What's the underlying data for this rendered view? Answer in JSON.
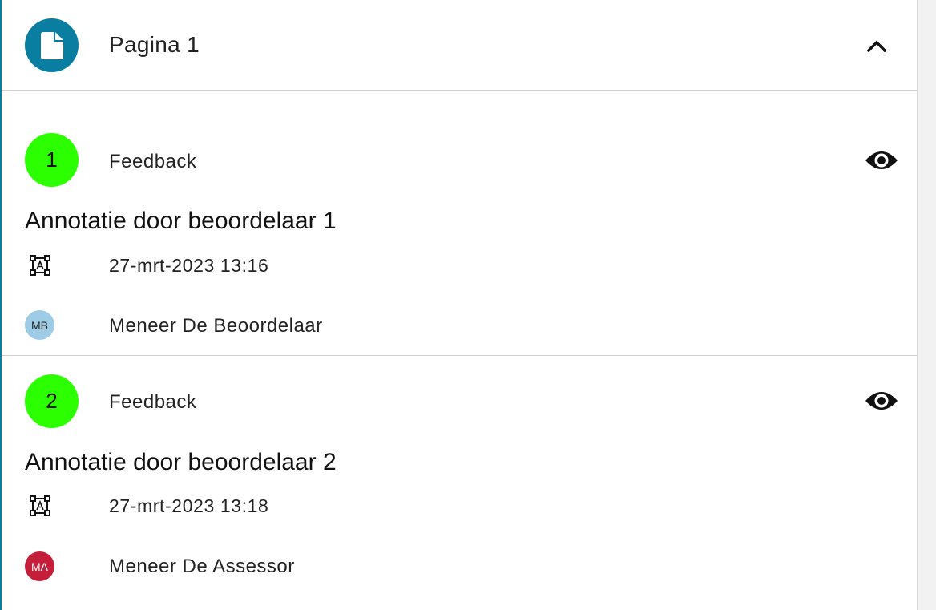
{
  "page": {
    "title": "Pagina 1",
    "icon": "document-icon",
    "accent_color": "#0a7ea0",
    "collapse_icon": "chevron-up-icon"
  },
  "annotations": [
    {
      "number": "1",
      "type_label": "Feedback",
      "badge_color": "#2bff00",
      "title": "Annotatie door beoordelaar 1",
      "date": "27-mrt-2023 13:16",
      "date_icon": "text-box-icon",
      "user_initials": "MB",
      "user_name": "Meneer De Beoordelaar",
      "user_color": "#9ecbe6",
      "user_text_color": "#222222",
      "view_icon": "eye-icon"
    },
    {
      "number": "2",
      "type_label": "Feedback",
      "badge_color": "#2bff00",
      "title": "Annotatie door beoordelaar 2",
      "date": "27-mrt-2023 13:18",
      "date_icon": "text-box-icon",
      "user_initials": "MA",
      "user_name": "Meneer De Assessor",
      "user_color": "#c41e3a",
      "user_text_color": "#ffffff",
      "view_icon": "eye-icon"
    }
  ]
}
